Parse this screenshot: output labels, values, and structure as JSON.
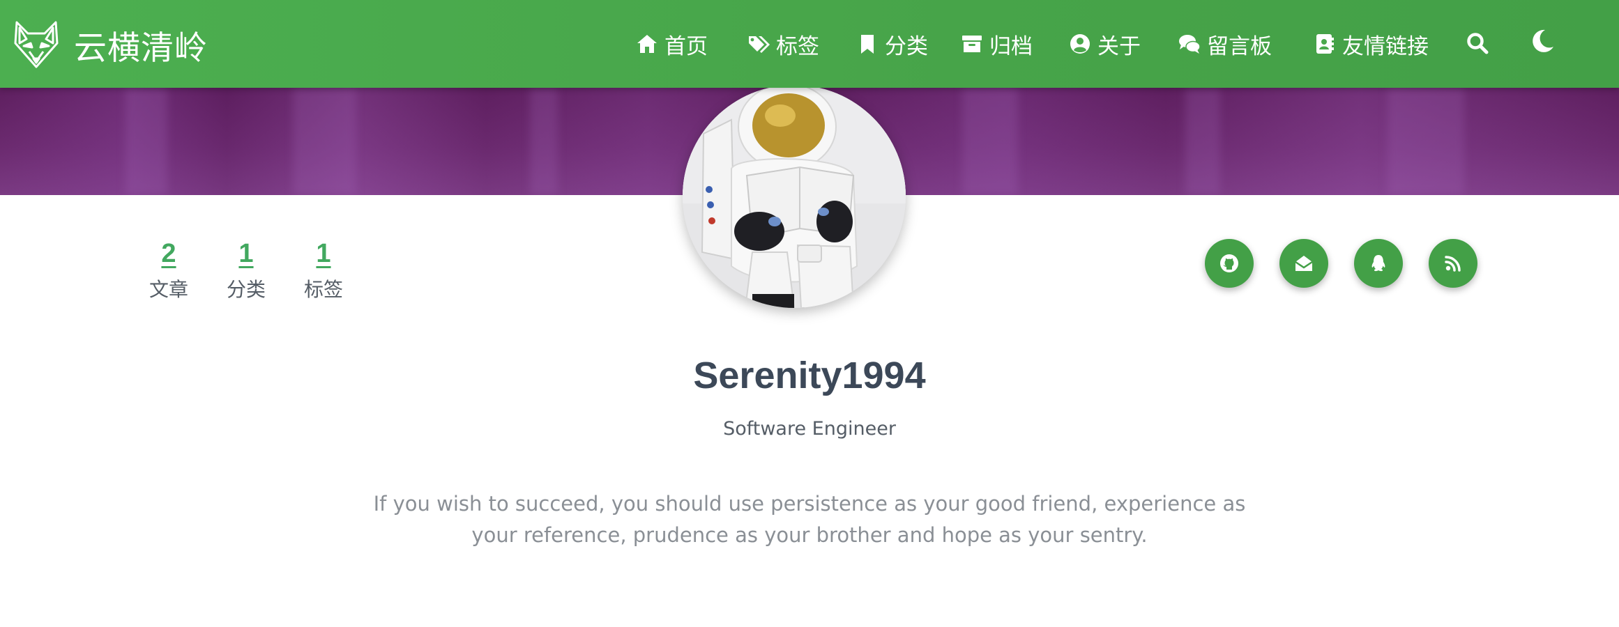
{
  "site": {
    "title": "云横清岭",
    "logo_icon": "fox-head-icon"
  },
  "nav": {
    "items": [
      {
        "label": "首页",
        "icon": "home-icon"
      },
      {
        "label": "标签",
        "icon": "tags-icon"
      },
      {
        "label": "分类",
        "icon": "bookmark-icon"
      },
      {
        "label": "归档",
        "icon": "archive-icon"
      },
      {
        "label": "关于",
        "icon": "user-circle-icon"
      },
      {
        "label": "留言板",
        "icon": "comments-icon"
      },
      {
        "label": "友情链接",
        "icon": "address-book-icon"
      }
    ],
    "search_icon": "search-icon",
    "theme_icon": "moon-icon"
  },
  "stats": [
    {
      "value": "2",
      "label": "文章"
    },
    {
      "value": "1",
      "label": "分类"
    },
    {
      "value": "1",
      "label": "标签"
    }
  ],
  "social": [
    {
      "icon": "github-icon"
    },
    {
      "icon": "envelope-open-icon"
    },
    {
      "icon": "qq-icon"
    },
    {
      "icon": "rss-icon"
    }
  ],
  "profile": {
    "name": "Serenity1994",
    "title": "Software Engineer",
    "motto": "If you wish to succeed, you should use persistence as your good friend, experience as your reference, prudence as your brother and hope as your sentry."
  },
  "colors": {
    "navbar": "#4caf50",
    "accent": "#42a85f",
    "social_button": "#43a047",
    "banner": "#6b2a6f",
    "text_dark": "#3c4858",
    "text_muted": "#8a8f95"
  }
}
